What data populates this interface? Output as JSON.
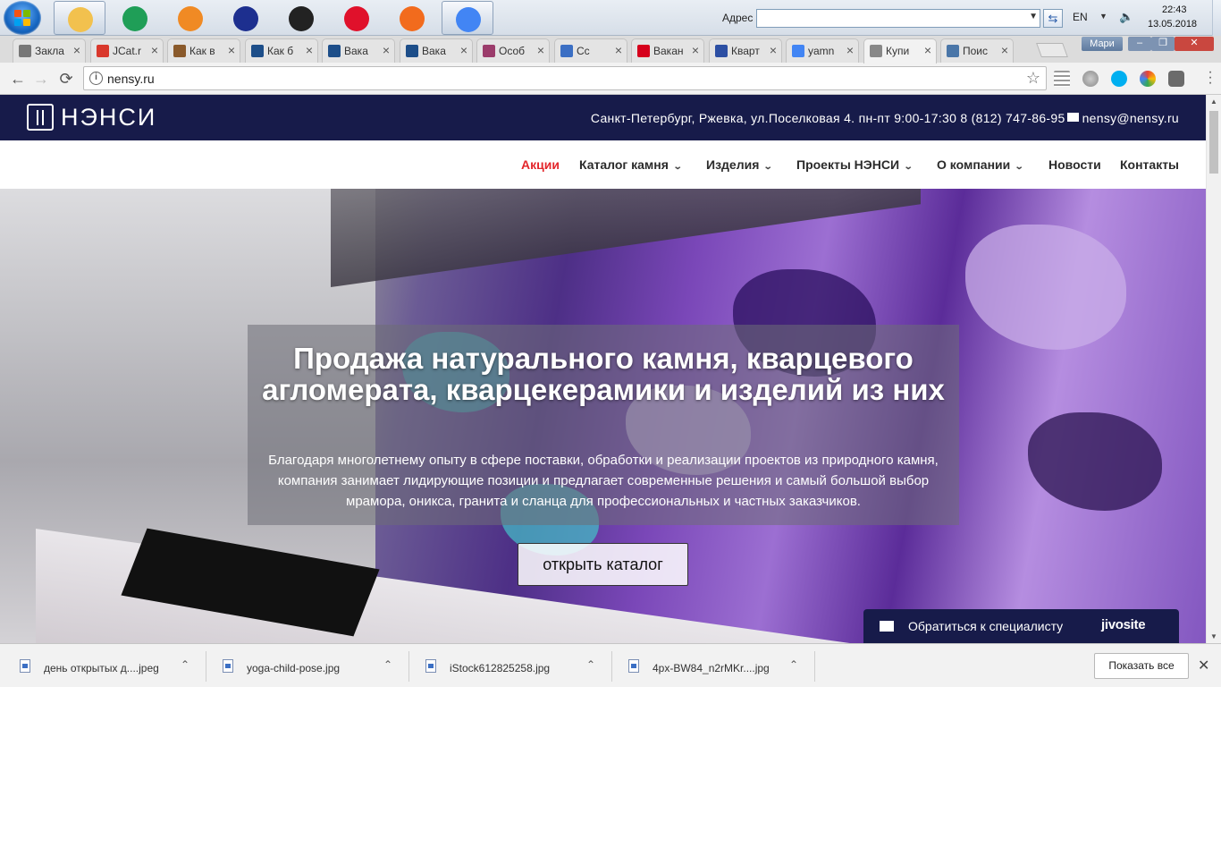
{
  "taskbar": {
    "address_label": "Адрес",
    "address_value": "",
    "go_glyph": "⇆",
    "language": "EN",
    "time": "22:43",
    "date": "13.05.2018",
    "apps": [
      {
        "name": "file-explorer-icon",
        "color": "#f2c14e",
        "active": true
      },
      {
        "name": "security-icon",
        "color": "#1f9e57",
        "active": false
      },
      {
        "name": "media-player-icon",
        "color": "#f08a24",
        "active": false
      },
      {
        "name": "user-app-icon",
        "color": "#1d2f8f",
        "active": false
      },
      {
        "name": "clock-app-icon",
        "color": "#222222",
        "active": false
      },
      {
        "name": "opera-icon",
        "color": "#e0112b",
        "active": false
      },
      {
        "name": "firefox-icon",
        "color": "#f26b1d",
        "active": false
      },
      {
        "name": "chrome-icon",
        "color": "#4285f4",
        "active": true
      }
    ]
  },
  "tabs": [
    {
      "title": "Закла",
      "icon": "star-icon",
      "color": "#777777"
    },
    {
      "title": "JCat.r",
      "icon": "jcat-icon",
      "color": "#d9382c"
    },
    {
      "title": "Как в",
      "icon": "cat-icon",
      "color": "#8a5a2b"
    },
    {
      "title": "Как б",
      "icon": "tie-icon",
      "color": "#1d4e89"
    },
    {
      "title": "Вака",
      "icon": "superjob-icon",
      "color": "#1d4e89"
    },
    {
      "title": "Вака",
      "icon": "superjob-icon",
      "color": "#1d4e89"
    },
    {
      "title": "Особ",
      "icon": "k-icon",
      "color": "#9b3c6b"
    },
    {
      "title": "Сс",
      "icon": "play-icon",
      "color": "#3b6fc4"
    },
    {
      "title": "Вакан",
      "icon": "hh-icon",
      "color": "#d6001c"
    },
    {
      "title": "Кварт",
      "icon": "flag-icon",
      "color": "#2c4fa3"
    },
    {
      "title": "yamn",
      "icon": "google-icon",
      "color": "#4285f4"
    },
    {
      "title": "Купи",
      "icon": "page-icon",
      "color": "#888888",
      "active": true
    },
    {
      "title": "Поис",
      "icon": "vk-icon",
      "color": "#4a76a8"
    }
  ],
  "window": {
    "profile": "Мари",
    "minimize": "–",
    "maximize": "❐",
    "close": "✕"
  },
  "toolbar": {
    "url": "nensy.ru",
    "back": "←",
    "forward": "→",
    "reload": "⟳",
    "star": "☆"
  },
  "site": {
    "logo": "НЭНСИ",
    "address": "Санкт-Петербург, Ржевка, ул.Поселковая 4.",
    "hours": "пн-пт 9:00-17:30",
    "phone": "8 (812) 747-86-95",
    "email": "nensy@nensy.ru",
    "nav": [
      {
        "label": "Акции",
        "dropdown": false
      },
      {
        "label": "Каталог камня",
        "dropdown": true
      },
      {
        "label": "Изделия",
        "dropdown": true
      },
      {
        "label": "Проекты НЭНСИ",
        "dropdown": true
      },
      {
        "label": "О компании",
        "dropdown": true
      },
      {
        "label": "Новости",
        "dropdown": false
      },
      {
        "label": "Контакты",
        "dropdown": false
      }
    ],
    "hero": {
      "title": "Продажа натурального камня, кварцевого агломерата, кварцекерамики и изделий из них",
      "text": "Благодаря многолетнему опыту в сфере поставки, обработки и реализации проектов из природного камня, компания занимает лидирующие позиции и предлагает современные решения и самый большой выбор мрамора, оникса, гранита и сланца для профессиональных и частных заказчиков.",
      "button": "открыть каталог"
    },
    "chat": {
      "label": "Обратиться к специалисту",
      "brand": "jivosite"
    }
  },
  "downloads": {
    "files": [
      "день открытых д....jpeg",
      "yoga-child-pose.jpg",
      "iStock612825258.jpg",
      "4px-BW84_n2rMKr....jpg"
    ],
    "show_all": "Показать все",
    "close": "✕"
  }
}
